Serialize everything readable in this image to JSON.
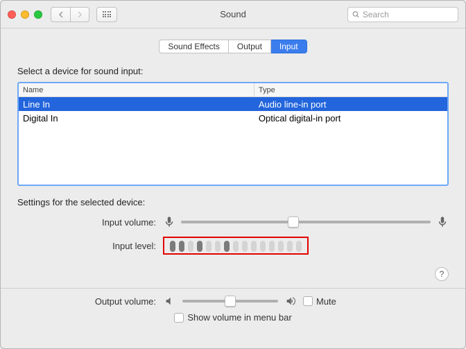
{
  "window": {
    "title": "Sound"
  },
  "search": {
    "placeholder": "Search"
  },
  "tabs": {
    "effects": "Sound Effects",
    "output": "Output",
    "input": "Input",
    "active": "input"
  },
  "inputSection": {
    "heading": "Select a device for sound input:",
    "cols": {
      "name": "Name",
      "type": "Type"
    },
    "rows": [
      {
        "name": "Line In",
        "type": "Audio line-in port",
        "selected": true
      },
      {
        "name": "Digital In",
        "type": "Optical digital-in port",
        "selected": false
      }
    ]
  },
  "settings": {
    "heading": "Settings for the selected device:",
    "volumeLabel": "Input volume:",
    "volumePct": 45,
    "levelLabel": "Input level:",
    "levelBars": [
      1,
      1,
      0,
      1,
      0,
      0,
      1,
      0,
      0,
      0,
      0,
      0,
      0,
      0,
      0
    ]
  },
  "output": {
    "label": "Output volume:",
    "pct": 50,
    "mute": "Mute",
    "showInMenu": "Show volume in menu bar"
  }
}
